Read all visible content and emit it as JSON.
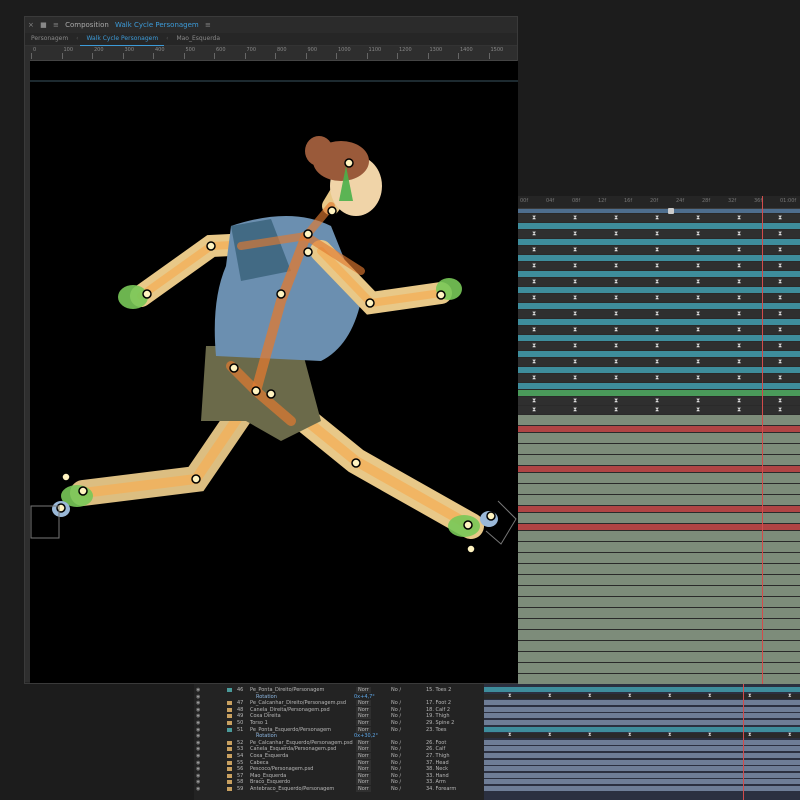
{
  "composition": {
    "header_prefix": "Composition",
    "header_name": "Walk Cycle Personagem",
    "tabs": [
      "Personagem",
      "Walk Cycle Personagem",
      "Mao_Esquerda"
    ],
    "active_tab": 1,
    "ruler_labels": [
      "0",
      "100",
      "200",
      "300",
      "400",
      "500",
      "600",
      "700",
      "800",
      "900",
      "1000",
      "1100",
      "1200",
      "1300",
      "1400",
      "1500"
    ]
  },
  "timeline": {
    "ruler_labels": [
      "00f",
      "04f",
      "08f",
      "12f",
      "16f",
      "20f",
      "24f",
      "28f",
      "32f",
      "36f",
      "01:00f"
    ]
  },
  "colors": {
    "track_blue": "#3e8d9c",
    "track_red": "#b04444",
    "track_green": "#4a9a5a",
    "track_olive": "#8a7a5a",
    "track_sage": "#7d8c7a",
    "bar_dark": "#2f2f2f",
    "accent": "#3d9bd8",
    "playhead": "#d24b4b"
  },
  "layers": [
    {
      "num": "46",
      "name": "Pe_Ponta_Direito/Personagem",
      "mode": "Norr",
      "track": "No ∕",
      "parent": "15. Toes 2",
      "color": "#4a9a9a"
    },
    {
      "sub": "Rotation",
      "value": "0x+4,7°"
    },
    {
      "num": "47",
      "name": "Pe_Calcanhar_Direito/Personagem.psd",
      "mode": "Norr",
      "track": "No ∕",
      "parent": "17. Foot 2",
      "color": "#c8a060"
    },
    {
      "num": "48",
      "name": "Canela_Direita/Personagem.psd",
      "mode": "Norr",
      "track": "No ∕",
      "parent": "18. Calf 2",
      "color": "#c8a060"
    },
    {
      "num": "49",
      "name": "Coxa Direita",
      "mode": "Norr",
      "track": "No ∕",
      "parent": "19. Thigh",
      "color": "#c8a060"
    },
    {
      "num": "50",
      "name": "Torso 1",
      "mode": "Norr",
      "track": "No ∕",
      "parent": "29. Spine 2",
      "color": "#c8a060"
    },
    {
      "num": "51",
      "name": "Pe_Ponta_Esquerdo/Personagem",
      "mode": "Norr",
      "track": "No ∕",
      "parent": "23. Toes",
      "color": "#4a9a9a"
    },
    {
      "sub": "Rotation",
      "value": "0x+30,2°"
    },
    {
      "num": "52",
      "name": "Pe_Calcanhar_Esquerdo/Personagem.psd",
      "mode": "Norr",
      "track": "No ∕",
      "parent": "26. Foot",
      "color": "#c8a060"
    },
    {
      "num": "53",
      "name": "Canela_Esquerda/Personagem.psd",
      "mode": "Norr",
      "track": "No ∕",
      "parent": "26. Calf",
      "color": "#c8a060"
    },
    {
      "num": "54",
      "name": "Coxa_Esquerda",
      "mode": "Norr",
      "track": "No ∕",
      "parent": "27. Thigh",
      "color": "#c8a060"
    },
    {
      "num": "55",
      "name": "Cabeca",
      "mode": "Norr",
      "track": "No ∕",
      "parent": "37. Head",
      "color": "#c8a060"
    },
    {
      "num": "56",
      "name": "Pescoco/Personagem.psd",
      "mode": "Norr",
      "track": "No ∕",
      "parent": "38. Neck",
      "color": "#c8a060"
    },
    {
      "num": "57",
      "name": "Mao_Esquerda",
      "mode": "Norr",
      "track": "No ∕",
      "parent": "33. Hand",
      "color": "#c8a060"
    },
    {
      "num": "58",
      "name": "Braco_Esquerdo",
      "mode": "Norr",
      "track": "No ∕",
      "parent": "33. Arm",
      "color": "#c8a060"
    },
    {
      "num": "59",
      "name": "Antebraco_Esquerdo/Personagem",
      "mode": "Norr",
      "track": "No ∕",
      "parent": "34. Forearm",
      "color": "#c8a060"
    }
  ]
}
